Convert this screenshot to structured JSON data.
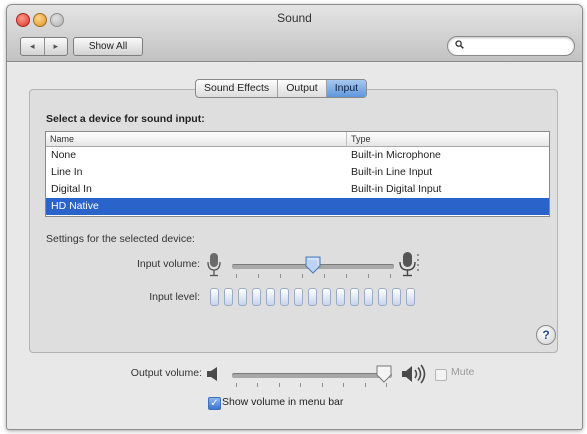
{
  "window": {
    "title": "Sound"
  },
  "toolbar": {
    "back_label": "◂",
    "forward_label": "▸",
    "show_all_label": "Show All",
    "search_placeholder": ""
  },
  "tabs": [
    {
      "label": "Sound Effects",
      "active": false
    },
    {
      "label": "Output",
      "active": false
    },
    {
      "label": "Input",
      "active": true
    }
  ],
  "input": {
    "select_label": "Select a device for sound input:",
    "columns": {
      "name": "Name",
      "type": "Type"
    },
    "devices": [
      {
        "name": "None",
        "type": "Built-in Microphone"
      },
      {
        "name": "Line In",
        "type": "Built-in Line Input"
      },
      {
        "name": "Digital In",
        "type": "Built-in Digital Input"
      },
      {
        "name": "HD Native",
        "type": ""
      }
    ],
    "selected_index": 3,
    "settings_label": "Settings for the selected device:",
    "input_volume_label": "Input volume:",
    "input_volume_fraction": 0.5,
    "input_level_label": "Input level:",
    "input_level_segments": 15,
    "help_label": "?"
  },
  "output": {
    "volume_label": "Output volume:",
    "volume_fraction": 0.95,
    "mute_label": "Mute",
    "mute_checked": false,
    "mute_enabled": false,
    "show_in_menu_bar_label": "Show volume in menu bar",
    "show_in_menu_bar_checked": true
  },
  "colors": {
    "selection": "#2a63c9",
    "active_tab": "#5e97de"
  }
}
